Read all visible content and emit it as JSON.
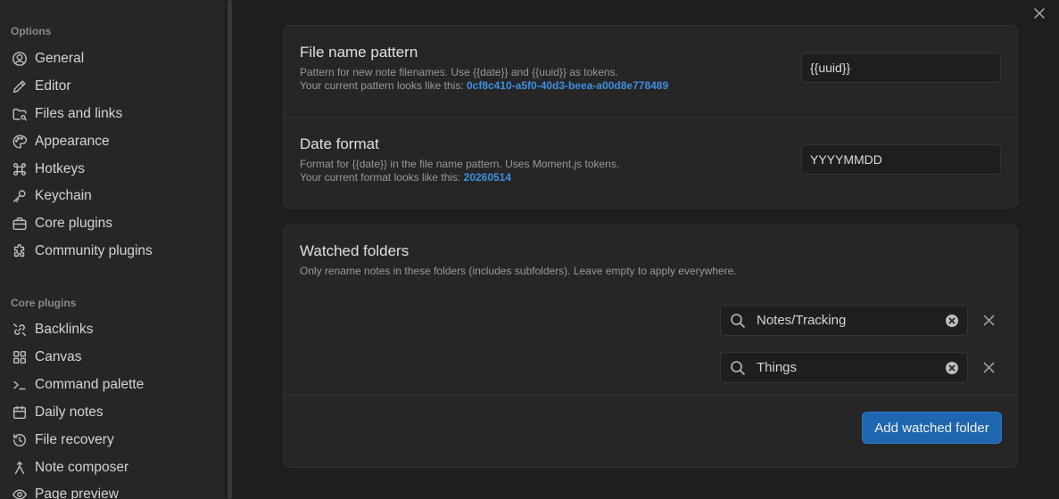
{
  "sidebar": {
    "options_heading": "Options",
    "options_items": [
      {
        "label": "General",
        "icon": "user-circle-icon"
      },
      {
        "label": "Editor",
        "icon": "pencil-icon"
      },
      {
        "label": "Files and links",
        "icon": "folder-link-icon"
      },
      {
        "label": "Appearance",
        "icon": "palette-icon"
      },
      {
        "label": "Hotkeys",
        "icon": "command-icon"
      },
      {
        "label": "Keychain",
        "icon": "key-icon"
      },
      {
        "label": "Core plugins",
        "icon": "briefcase-icon"
      },
      {
        "label": "Community plugins",
        "icon": "puzzle-icon"
      }
    ],
    "core_plugins_heading": "Core plugins",
    "core_plugin_items": [
      {
        "label": "Backlinks",
        "icon": "backlinks-icon"
      },
      {
        "label": "Canvas",
        "icon": "canvas-grid-icon"
      },
      {
        "label": "Command palette",
        "icon": "terminal-icon"
      },
      {
        "label": "Daily notes",
        "icon": "calendar-icon"
      },
      {
        "label": "File recovery",
        "icon": "history-icon"
      },
      {
        "label": "Note composer",
        "icon": "merge-icon"
      },
      {
        "label": "Page preview",
        "icon": "eye-icon"
      }
    ]
  },
  "settings": {
    "file_name_pattern": {
      "title": "File name pattern",
      "desc_line1": "Pattern for new note filenames. Use {{date}} and {{uuid}} as tokens.",
      "desc_line2_prefix": "Your current pattern looks like this: ",
      "example": "0cf8c410-a5f0-40d3-beea-a00d8e778489",
      "value": "{{uuid}}"
    },
    "date_format": {
      "title": "Date format",
      "desc_line1": "Format for {{date}} in the file name pattern. Uses Moment.js tokens.",
      "desc_line2_prefix": "Your current format looks like this: ",
      "example": "20260514",
      "value": "YYYYMMDD"
    },
    "watched_folders": {
      "title": "Watched folders",
      "desc": "Only rename notes in these folders (includes subfolders). Leave empty to apply everywhere.",
      "folders": [
        "Notes/Tracking",
        "Things"
      ],
      "add_button_label": "Add watched folder"
    }
  },
  "colors": {
    "accent": "#3d8fe0",
    "button": "#1e66b0",
    "background": "#1e1e1e",
    "sidebar": "#262626"
  }
}
